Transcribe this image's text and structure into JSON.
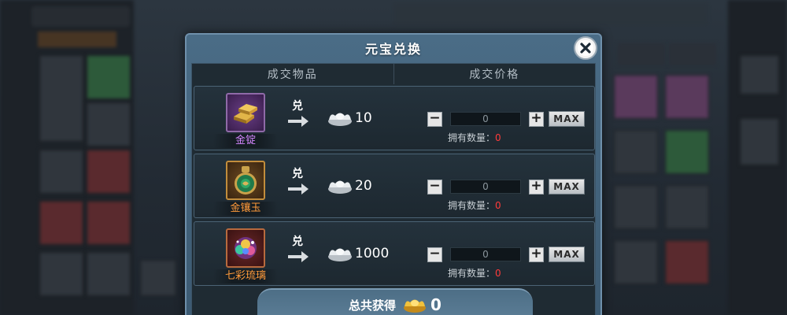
{
  "dialog": {
    "title": "元宝兑换",
    "headers": {
      "items": "成交物品",
      "price": "成交价格"
    },
    "rows": [
      {
        "name": "金锭",
        "name_color": "purple",
        "exchange_label": "兑",
        "amount": "10",
        "qty": "0",
        "own_label": "拥有数量：",
        "own_value": "0",
        "max_label": "MAX",
        "minus_label": "−",
        "plus_label": "+"
      },
      {
        "name": "金镶玉",
        "name_color": "orange",
        "exchange_label": "兑",
        "amount": "20",
        "qty": "0",
        "own_label": "拥有数量：",
        "own_value": "0",
        "max_label": "MAX",
        "minus_label": "−",
        "plus_label": "+"
      },
      {
        "name": "七彩琉璃",
        "name_color": "orange",
        "exchange_label": "兑",
        "amount": "1000",
        "qty": "0",
        "own_label": "拥有数量：",
        "own_value": "0",
        "max_label": "MAX",
        "minus_label": "−",
        "plus_label": "+"
      }
    ],
    "total": {
      "label": "总共获得",
      "value": "0"
    }
  },
  "icons": {
    "close": "close-icon",
    "arrow": "arrow-right-icon",
    "ingot": "silver-ingot-icon",
    "gold_ingot": "gold-ingot-icon"
  },
  "colors": {
    "own_value": "#ff3b3b",
    "purple_name": "#d486ff",
    "orange_name": "#ff9a3a"
  }
}
